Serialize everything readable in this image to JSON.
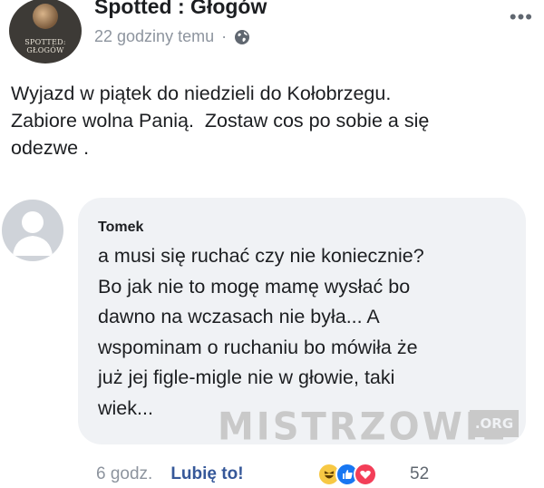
{
  "post": {
    "page_name": "Spotted : Głogów",
    "avatar_text": "SPOTTED: GŁOGÓW",
    "time": "22 godziny temu",
    "separator": "·",
    "privacy_icon": "globe-icon",
    "more_label": "•••",
    "text": "Wyjazd w piątek do niedzieli do Kołobrzegu.\nZabiore wolna Panią.  Zostaw cos po sobie a się\nodezwe ."
  },
  "comment": {
    "author": "Tomek",
    "text": "a musi się ruchać czy nie koniecznie?\nBo jak nie to mogę mamę wysłać bo\ndawno na wczasach nie była... A\nwspominam o ruchaniu bo mówiła że\njuż jej figle-migle nie w głowie, taki\nwiek...",
    "time": "6 godz.",
    "like_label": "Lubię to!",
    "reactions": [
      "haha-icon",
      "like-icon",
      "love-icon"
    ],
    "reaction_count": "52"
  },
  "watermark": {
    "main": "MISTRZOWIE",
    "suffix": ".ORG"
  },
  "colors": {
    "link": "#365899",
    "meta": "#8d949e",
    "bubble": "#f0f2f5"
  }
}
